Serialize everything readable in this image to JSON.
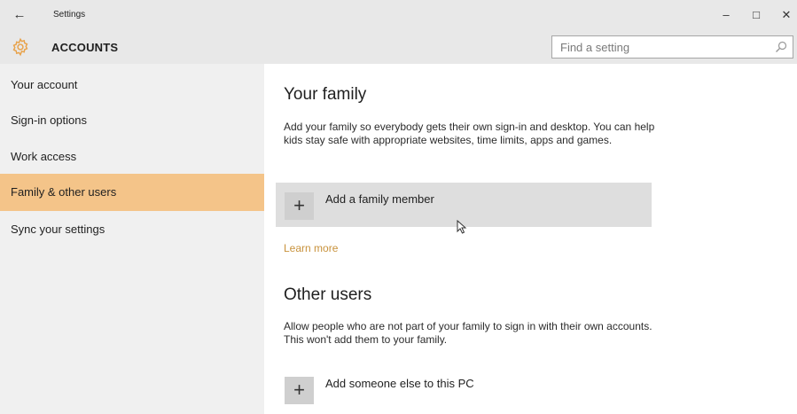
{
  "window": {
    "app_title": "Settings",
    "back_glyph": "←",
    "minimize_glyph": "–",
    "maximize_glyph": "□",
    "close_glyph": "✕"
  },
  "header": {
    "icon": "gear-icon",
    "title": "ACCOUNTS",
    "search_placeholder": "Find a setting",
    "search_icon": "search-icon"
  },
  "sidebar": {
    "selected_index": 3,
    "items": [
      {
        "label": "Your account"
      },
      {
        "label": "Sign-in options"
      },
      {
        "label": "Work access"
      },
      {
        "label": "Family & other users"
      },
      {
        "label": "Sync your settings"
      }
    ]
  },
  "main": {
    "family": {
      "heading": "Your family",
      "description": "Add your family so everybody gets their own sign-in and desktop. You can help kids stay safe with appropriate websites, time limits, apps and games.",
      "add_label": "Add a family member",
      "plus_glyph": "+",
      "learn_more": "Learn more"
    },
    "other": {
      "heading": "Other users",
      "description": "Allow people who are not part of your family to sign in with their own accounts. This won't add them to your family.",
      "add_label": "Add someone else to this PC",
      "plus_glyph": "+"
    }
  },
  "colors": {
    "accent": "#f4c489",
    "link": "#c8923c",
    "chrome": "#e8e8e8",
    "sidebar_bg": "#f0f0f0"
  }
}
